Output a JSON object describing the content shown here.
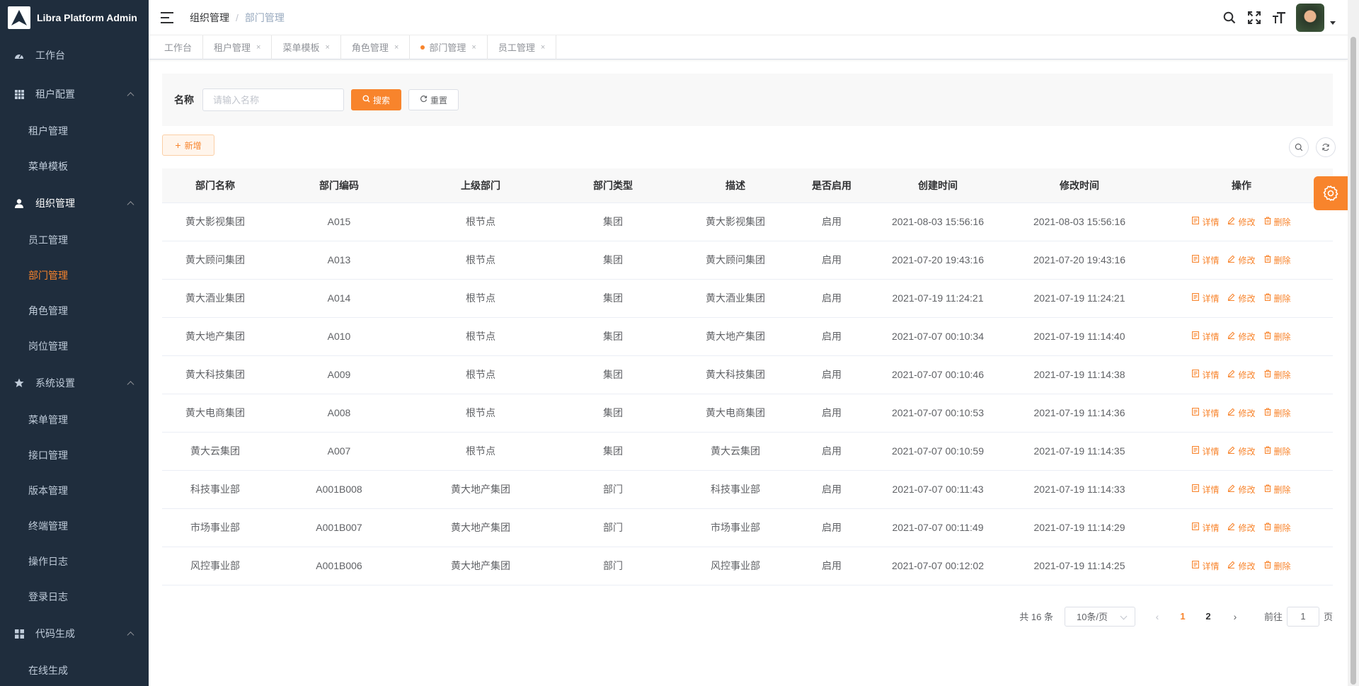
{
  "app": {
    "title": "Libra Platform Admin"
  },
  "sidebar": {
    "items": [
      {
        "label": "工作台",
        "icon": "dashboard-icon"
      },
      {
        "label": "租户配置",
        "icon": "grid-icon",
        "children": [
          "租户管理",
          "菜单模板"
        ]
      },
      {
        "label": "组织管理",
        "icon": "user-icon",
        "children": [
          "员工管理",
          "部门管理",
          "角色管理",
          "岗位管理"
        ]
      },
      {
        "label": "系统设置",
        "icon": "star-icon",
        "children": [
          "菜单管理",
          "接口管理",
          "版本管理",
          "终端管理",
          "操作日志",
          "登录日志"
        ]
      },
      {
        "label": "代码生成",
        "icon": "apps-icon",
        "children": [
          "在线生成"
        ]
      }
    ],
    "active": "部门管理"
  },
  "header": {
    "breadcrumb": [
      "组织管理",
      "部门管理"
    ],
    "separator": "/"
  },
  "tags": [
    {
      "label": "工作台",
      "closable": false,
      "active": false
    },
    {
      "label": "租户管理",
      "closable": true,
      "active": false
    },
    {
      "label": "菜单模板",
      "closable": true,
      "active": false
    },
    {
      "label": "角色管理",
      "closable": true,
      "active": false
    },
    {
      "label": "部门管理",
      "closable": true,
      "active": true
    },
    {
      "label": "员工管理",
      "closable": true,
      "active": false
    }
  ],
  "search": {
    "label": "名称",
    "placeholder": "请输入名称",
    "search_btn": "搜索",
    "reset_btn": "重置"
  },
  "toolbar": {
    "add_btn": "新增"
  },
  "table": {
    "columns": [
      "部门名称",
      "部门编码",
      "上级部门",
      "部门类型",
      "描述",
      "是否启用",
      "创建时间",
      "修改时间",
      "操作"
    ],
    "actions": [
      "详情",
      "修改",
      "删除"
    ],
    "rows": [
      [
        "黄大影视集团",
        "A015",
        "根节点",
        "集团",
        "黄大影视集团",
        "启用",
        "2021-08-03 15:56:16",
        "2021-08-03 15:56:16"
      ],
      [
        "黄大顾问集团",
        "A013",
        "根节点",
        "集团",
        "黄大顾问集团",
        "启用",
        "2021-07-20 19:43:16",
        "2021-07-20 19:43:16"
      ],
      [
        "黄大酒业集团",
        "A014",
        "根节点",
        "集团",
        "黄大酒业集团",
        "启用",
        "2021-07-19 11:24:21",
        "2021-07-19 11:24:21"
      ],
      [
        "黄大地产集团",
        "A010",
        "根节点",
        "集团",
        "黄大地产集团",
        "启用",
        "2021-07-07 00:10:34",
        "2021-07-19 11:14:40"
      ],
      [
        "黄大科技集团",
        "A009",
        "根节点",
        "集团",
        "黄大科技集团",
        "启用",
        "2021-07-07 00:10:46",
        "2021-07-19 11:14:38"
      ],
      [
        "黄大电商集团",
        "A008",
        "根节点",
        "集团",
        "黄大电商集团",
        "启用",
        "2021-07-07 00:10:53",
        "2021-07-19 11:14:36"
      ],
      [
        "黄大云集团",
        "A007",
        "根节点",
        "集团",
        "黄大云集团",
        "启用",
        "2021-07-07 00:10:59",
        "2021-07-19 11:14:35"
      ],
      [
        "科技事业部",
        "A001B008",
        "黄大地产集团",
        "部门",
        "科技事业部",
        "启用",
        "2021-07-07 00:11:43",
        "2021-07-19 11:14:33"
      ],
      [
        "市场事业部",
        "A001B007",
        "黄大地产集团",
        "部门",
        "市场事业部",
        "启用",
        "2021-07-07 00:11:49",
        "2021-07-19 11:14:29"
      ],
      [
        "风控事业部",
        "A001B006",
        "黄大地产集团",
        "部门",
        "风控事业部",
        "启用",
        "2021-07-07 00:12:02",
        "2021-07-19 11:14:25"
      ]
    ]
  },
  "pagination": {
    "total": "共 16 条",
    "page_size": "10条/页",
    "pages": [
      "1",
      "2"
    ],
    "current": "1",
    "goto_prefix": "前往",
    "goto_value": "1",
    "goto_suffix": "页",
    "prev": "‹",
    "next": "›"
  },
  "colors": {
    "accent": "#f8842c",
    "sidebar_bg": "#1f2d3d",
    "sidebar_text": "#bfcbd9"
  }
}
